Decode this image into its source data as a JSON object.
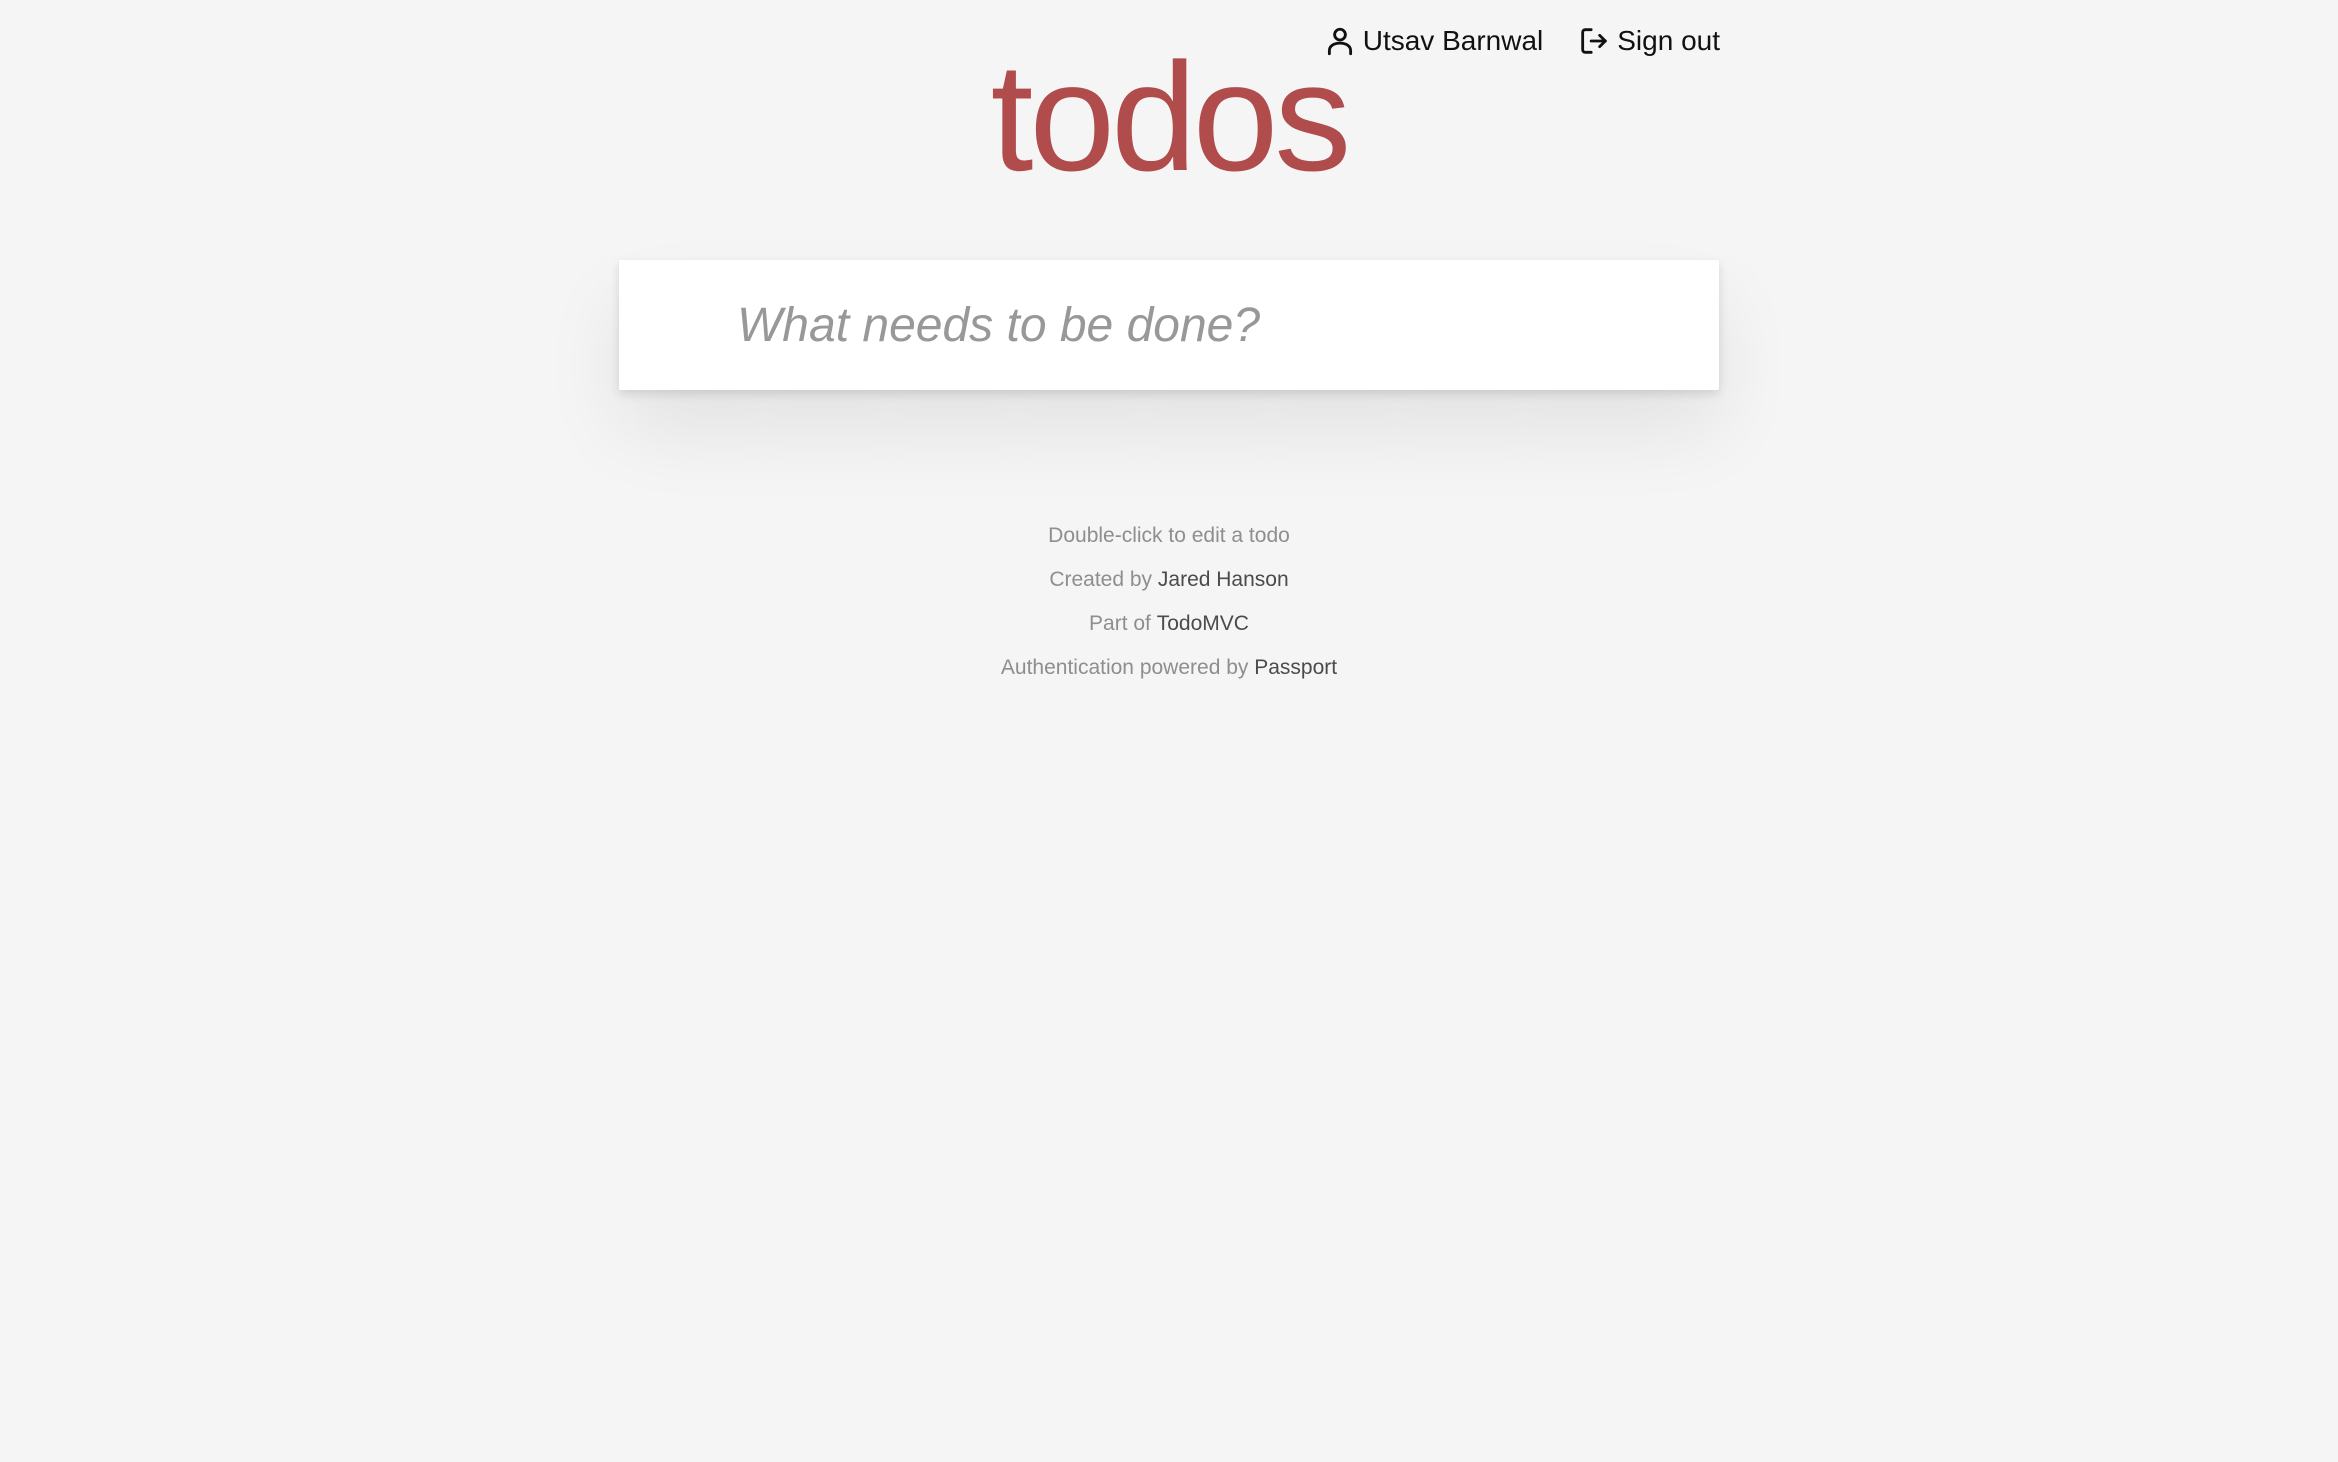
{
  "header": {
    "user": {
      "name": "Utsav Barnwal",
      "icon": "user-icon"
    },
    "sign_out": {
      "label": "Sign out",
      "icon": "sign-out-icon"
    }
  },
  "app": {
    "title": "todos"
  },
  "new_todo": {
    "value": "",
    "placeholder": "What needs to be done?"
  },
  "footer": {
    "hint": "Double-click to edit a todo",
    "created_by_prefix": "Created by",
    "created_by_name": "Jared Hanson",
    "part_of_prefix": "Part of",
    "part_of_name": "TodoMVC",
    "auth_prefix": "Authentication powered by",
    "auth_name": "Passport"
  },
  "colors": {
    "background": "#f5f5f5",
    "title": "#b04c4c",
    "panel": "#ffffff",
    "muted_text": "#8e8e8e",
    "link_text": "#4b4b4b"
  }
}
